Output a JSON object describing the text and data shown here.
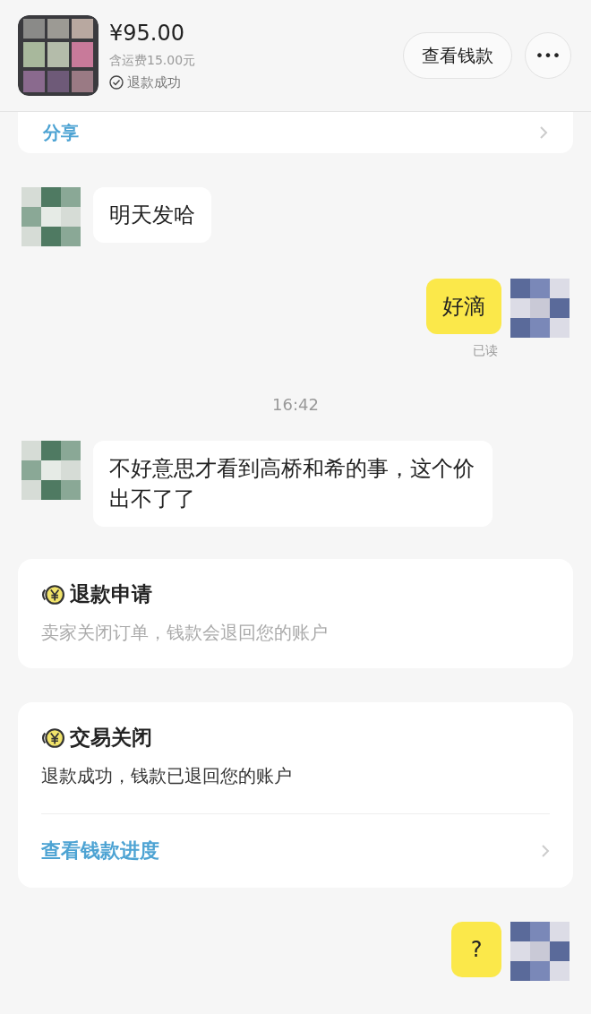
{
  "order": {
    "price": "¥95.00",
    "shipping": "含运费15.00元",
    "status": "退款成功",
    "button": "查看钱款",
    "more": "•••"
  },
  "share_card": {
    "label": "分享"
  },
  "messages": [
    {
      "kind": "incoming",
      "text": "明天发哈"
    },
    {
      "kind": "outgoing",
      "text": "好滴",
      "read": "已读"
    },
    {
      "kind": "time",
      "text": "16:42"
    },
    {
      "kind": "incoming",
      "text": "不好意思才看到高桥和希的事，这个价出不了了"
    },
    {
      "kind": "card",
      "title": "退款申请",
      "body": "卖家关闭订单，钱款会退回您的账户",
      "muted": true
    },
    {
      "kind": "card",
      "title": "交易关闭",
      "body": "退款成功，钱款已退回您的账户",
      "muted": false,
      "link": "查看钱款进度"
    },
    {
      "kind": "outgoing",
      "text": "?"
    }
  ]
}
